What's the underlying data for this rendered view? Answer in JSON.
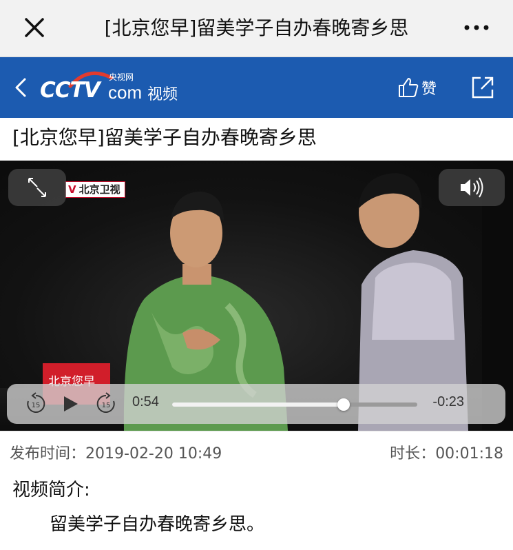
{
  "topbar": {
    "title": "[北京您早]留美学子自办春晚寄乡思",
    "close_icon": "close-icon",
    "more_icon": "more-icon"
  },
  "header": {
    "logo_cctv": "CCTV",
    "logo_yangshi": "央视网",
    "logo_com": "com",
    "section": "视频",
    "like_label": "赞",
    "back_icon": "back-icon",
    "share_icon": "share-icon",
    "brand_color": "#1c5bb0"
  },
  "video": {
    "title": "[北京您早]留美学子自办春晚寄乡思",
    "channel_badge_prefix": "V",
    "channel_badge": "北京卫视",
    "sign_text": "北京您早",
    "current_time": "0:54",
    "remaining_time": "-0:23",
    "progress": 0.7,
    "icons": [
      "fullscreen-icon",
      "volume-icon",
      "rewind-15-icon",
      "play-icon",
      "forward-15-icon"
    ]
  },
  "meta": {
    "publish_label": "发布时间：",
    "publish_time": "2019-02-20 10:49",
    "duration_label": "时长：",
    "duration": "00:01:18"
  },
  "intro": {
    "heading": "视频简介:",
    "text": "留美学子自办春晚寄乡思。"
  }
}
